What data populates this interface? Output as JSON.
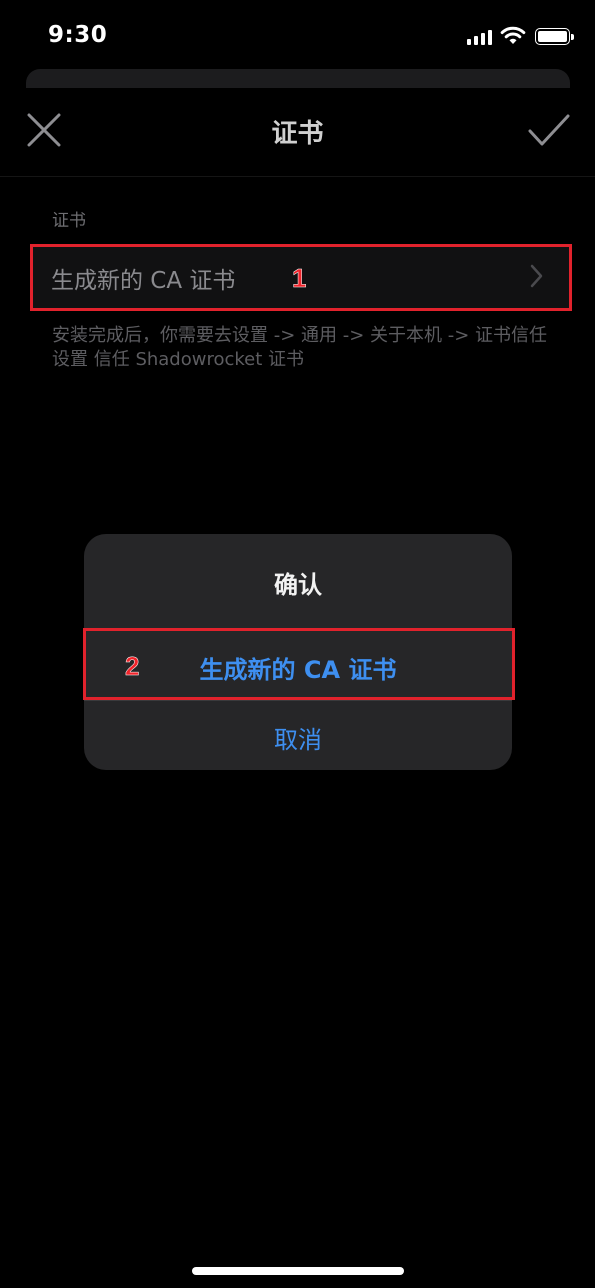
{
  "status_bar": {
    "time": "9:30"
  },
  "nav": {
    "title": "证书"
  },
  "section": {
    "header": "证书",
    "row_label": "生成新的 CA 证书",
    "footer": "安装完成后，你需要去设置 -> 通用 -> 关于本机 -> 证书信任设置 信任 Shadowrocket 证书"
  },
  "annotations": {
    "step1": "1",
    "step2": "2",
    "color": "#e1222c"
  },
  "alert": {
    "title": "确认",
    "action_label": "生成新的 CA 证书",
    "cancel_label": "取消",
    "action_color": "#3e8ff0"
  }
}
